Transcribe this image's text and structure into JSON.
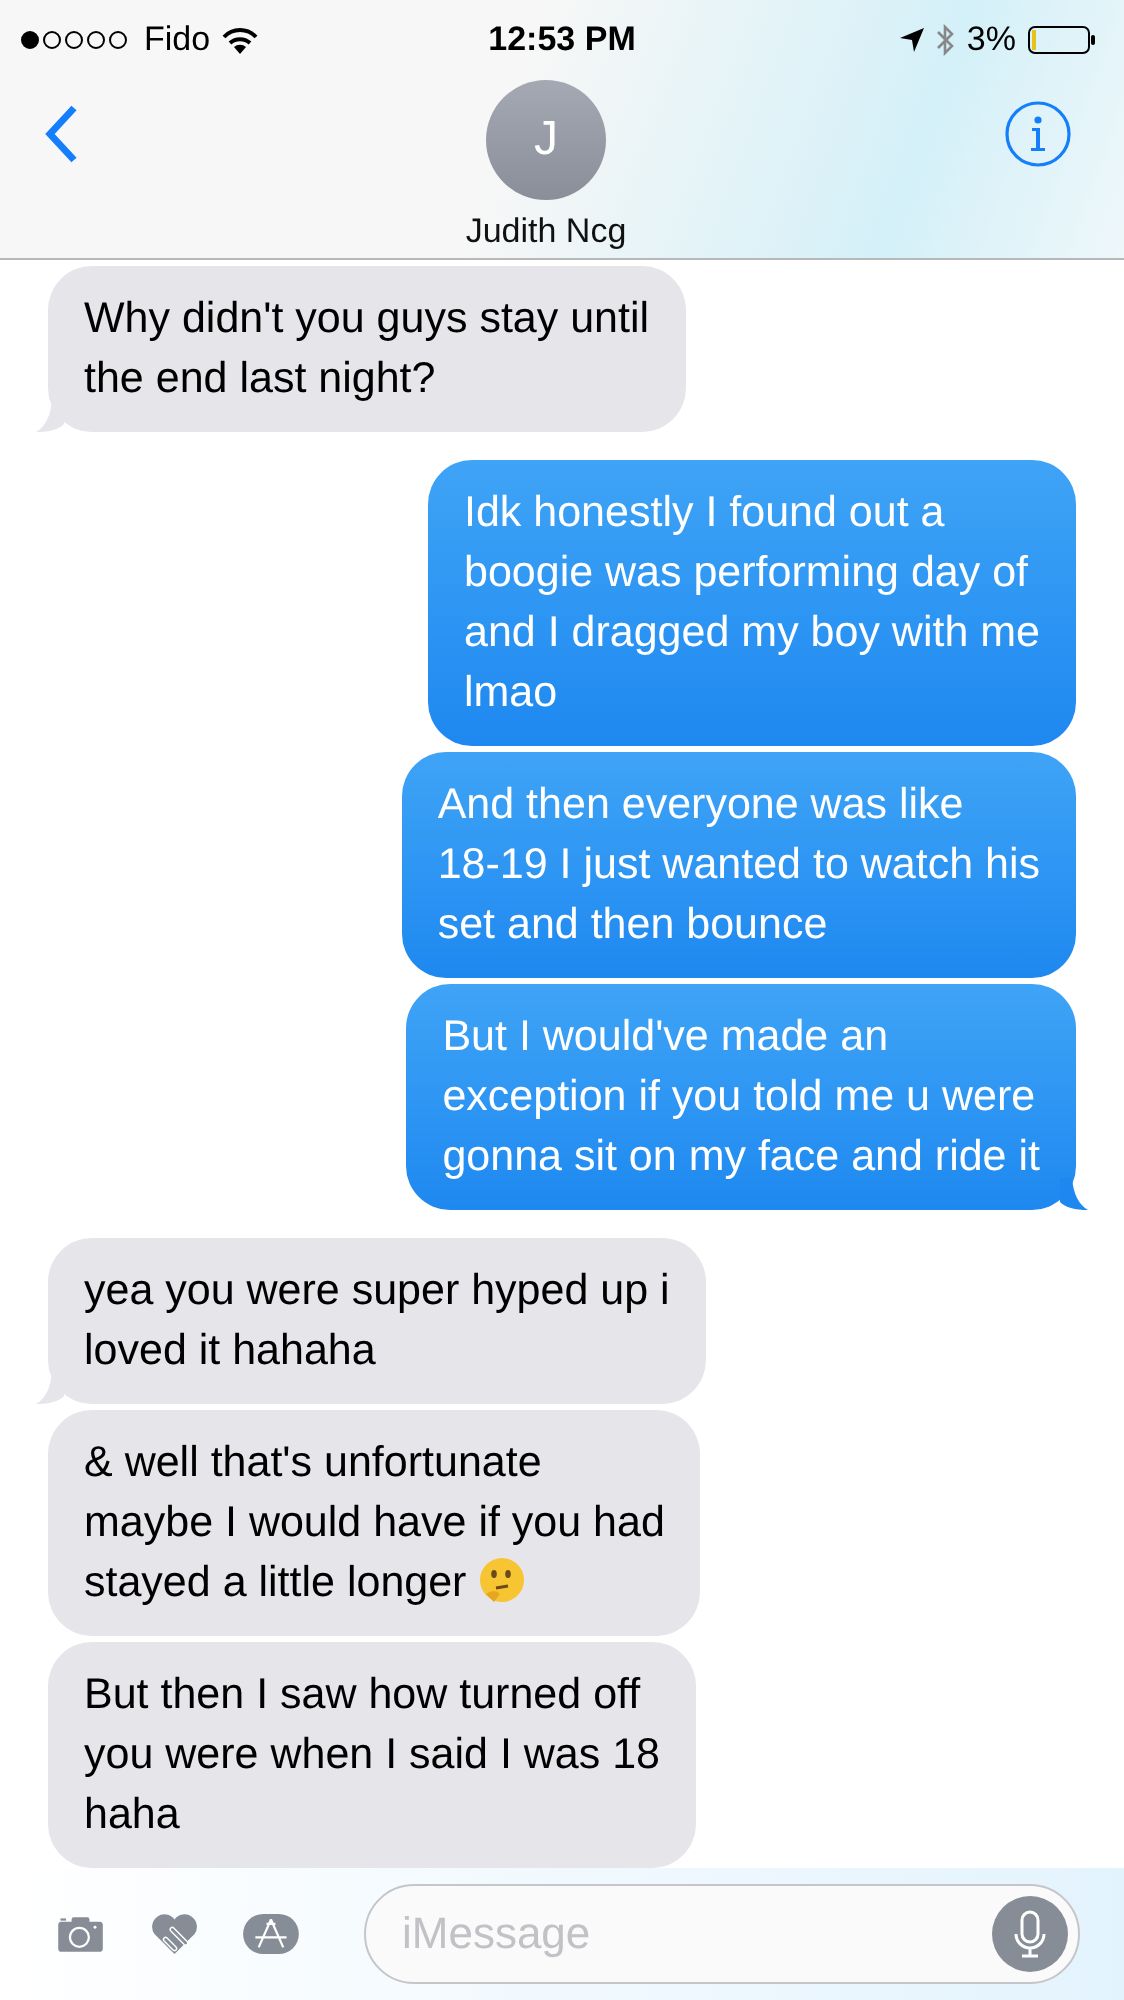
{
  "status_bar": {
    "carrier": "Fido",
    "time": "12:53 PM",
    "battery": "3%"
  },
  "header": {
    "avatar_initial": "J",
    "contact_name": "Judith Ncg"
  },
  "messages": [
    {
      "kind": "received",
      "tail": true,
      "text": "Why didn't you guys stay until\nthe end last night?"
    },
    {
      "kind": "sent",
      "tail": false,
      "text": "Idk honestly I found out a\nboogie was performing day of\nand I dragged my boy with me\nlmao"
    },
    {
      "kind": "sent",
      "tail": false,
      "text": "And then everyone was like\n18-19 I just wanted to watch his\nset and then bounce"
    },
    {
      "kind": "sent",
      "tail": true,
      "text": "But I would've made an\nexception if you told me u were\ngonna sit on my face and ride it"
    },
    {
      "kind": "received",
      "tail": true,
      "text": "yea you were super hyped up i\nloved it hahaha"
    },
    {
      "kind": "received",
      "tail": false,
      "text": "& well that's unfortunate\nmaybe I would have if you had\nstayed a little longer",
      "emoji": true
    },
    {
      "kind": "received",
      "tail": false,
      "text": "But then I saw how turned off\nyou were when I said I was 18\nhaha"
    }
  ],
  "composer": {
    "placeholder": "iMessage"
  }
}
